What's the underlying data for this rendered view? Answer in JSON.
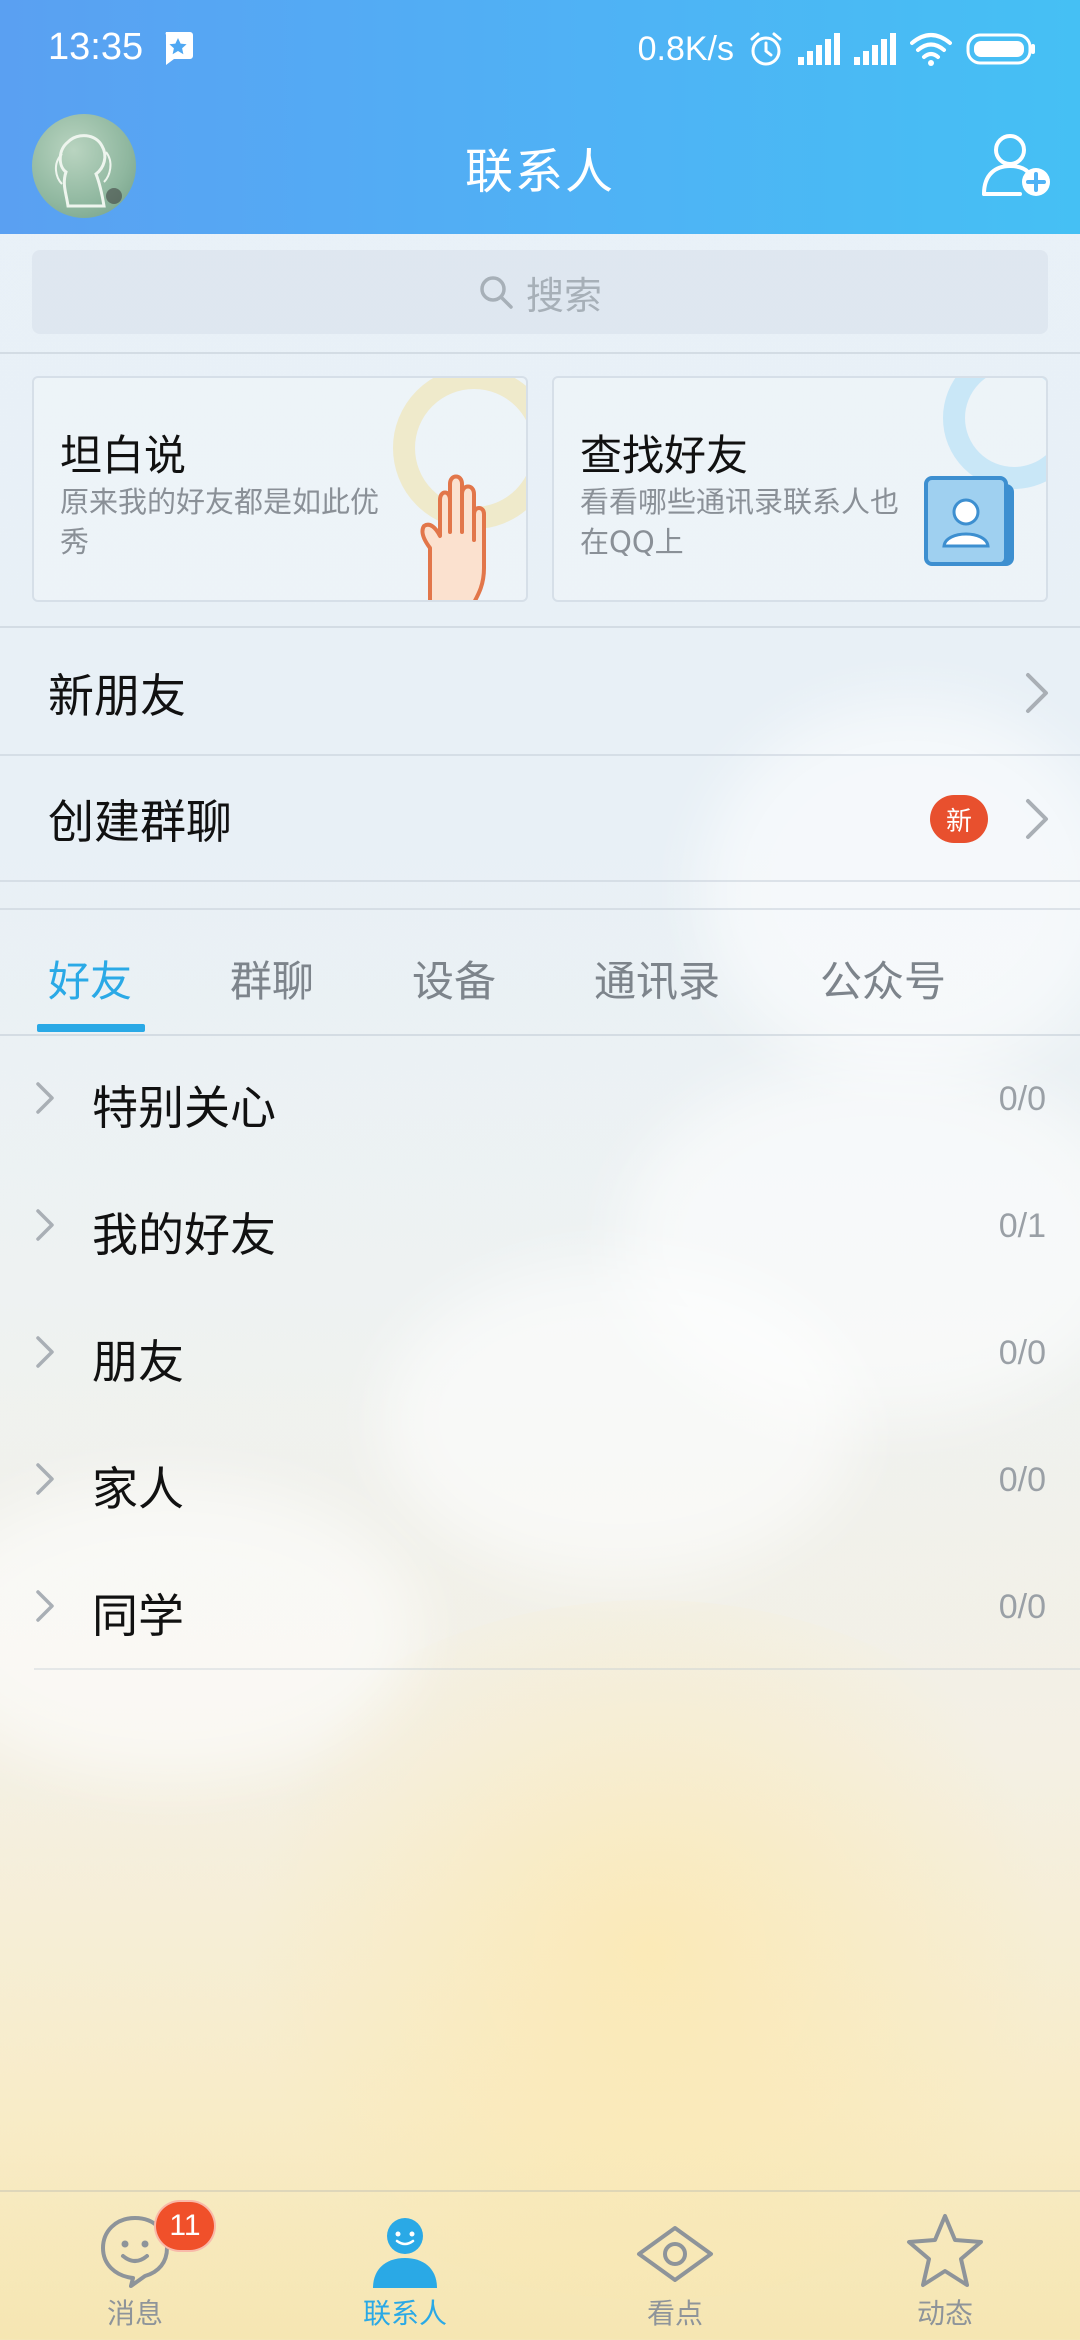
{
  "status_bar": {
    "time": "13:35",
    "network_speed": "0.8K/s",
    "icons": [
      "notification-app-icon",
      "alarm-icon",
      "signal-icon",
      "signal-icon",
      "wifi-icon",
      "battery-icon"
    ]
  },
  "header": {
    "title": "联系人",
    "avatar_icon": "user-avatar",
    "add_contact_icon": "add-contact-icon"
  },
  "search": {
    "placeholder": "搜索",
    "icon": "search-icon"
  },
  "cards": [
    {
      "title": "坦白说",
      "description": "原来我的好友都是如此优秀",
      "icon": "hand-icon"
    },
    {
      "title": "查找好友",
      "description": "看看哪些通讯录联系人也在QQ上",
      "icon": "contact-book-icon"
    }
  ],
  "menu": {
    "new_friends": "新朋友",
    "create_group": "创建群聊",
    "create_group_badge": "新"
  },
  "tabs": [
    {
      "label": "好友",
      "active": true
    },
    {
      "label": "群聊",
      "active": false
    },
    {
      "label": "设备",
      "active": false
    },
    {
      "label": "通讯录",
      "active": false
    },
    {
      "label": "公众号",
      "active": false
    }
  ],
  "groups": [
    {
      "name": "特别关心",
      "count": "0/0"
    },
    {
      "name": "我的好友",
      "count": "0/1"
    },
    {
      "name": "朋友",
      "count": "0/0"
    },
    {
      "name": "家人",
      "count": "0/0"
    },
    {
      "name": "同学",
      "count": "0/0"
    }
  ],
  "bottom_nav": [
    {
      "label": "消息",
      "icon": "chat-bubble-icon",
      "badge": "11",
      "active": false
    },
    {
      "label": "联系人",
      "icon": "contact-person-icon",
      "active": true
    },
    {
      "label": "看点",
      "icon": "eye-icon",
      "active": false
    },
    {
      "label": "动态",
      "icon": "star-icon",
      "active": false
    }
  ],
  "colors": {
    "header_gradient_start": "#5aa0f2",
    "header_gradient_end": "#45c0f4",
    "accent": "#2aa9e6",
    "badge": "#e8502e"
  }
}
